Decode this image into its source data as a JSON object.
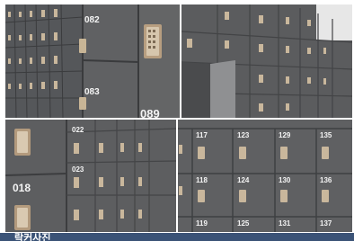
{
  "photos": {
    "top_left": {
      "visible_numbers": [
        "082",
        "083",
        "089"
      ]
    },
    "top_right": {
      "visible_numbers": []
    },
    "bottom_left": {
      "visible_numbers": [
        "018",
        "022",
        "023"
      ]
    },
    "bottom_right": {
      "visible_numbers": [
        "117",
        "123",
        "129",
        "135",
        "118",
        "124",
        "130",
        "136",
        "119",
        "125",
        "131",
        "137"
      ]
    }
  },
  "bottom_bar": {
    "text": "락커사진"
  },
  "colors": {
    "locker": "#5f6061",
    "locker_dark": "#4a4b4c",
    "divider": "#9a9a9a",
    "keypad": "#d9c2a5",
    "bar": "#3b5377"
  }
}
